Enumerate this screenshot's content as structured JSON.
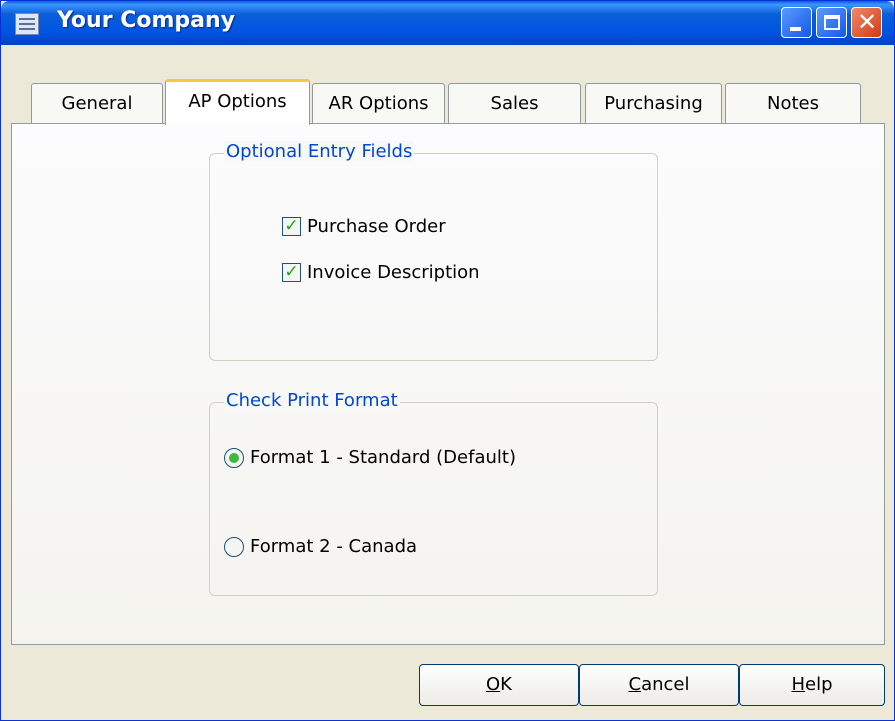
{
  "window": {
    "title": "Your Company"
  },
  "tabs": [
    {
      "label": "General"
    },
    {
      "label": "AP Options"
    },
    {
      "label": "AR Options"
    },
    {
      "label": "Sales"
    },
    {
      "label": "Purchasing"
    },
    {
      "label": "Notes"
    }
  ],
  "optional_entry": {
    "legend": "Optional Entry Fields",
    "fields": [
      {
        "label": "Purchase Order",
        "checked": true
      },
      {
        "label": "Invoice Description",
        "checked": true
      }
    ]
  },
  "check_print": {
    "legend": "Check Print Format",
    "options": [
      {
        "label": "Format 1 - Standard (Default)",
        "selected": true
      },
      {
        "label": "Format 2 - Canada",
        "selected": false
      }
    ]
  },
  "buttons": {
    "ok": {
      "mnemonic": "O",
      "rest": "K"
    },
    "cancel": {
      "mnemonic": "C",
      "rest": "ancel"
    },
    "help": {
      "mnemonic": "H",
      "rest": "elp"
    }
  }
}
